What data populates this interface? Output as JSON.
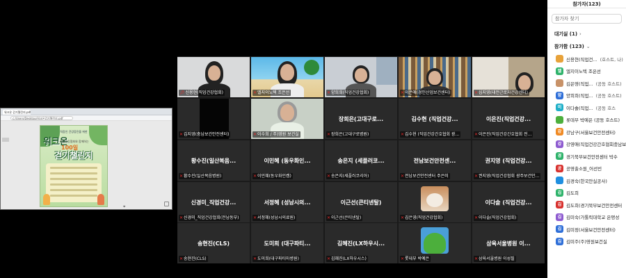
{
  "share": {
    "tab_title": "워크온 걷기챌린지.pdf",
    "url": "c:/Users/Desktop/워크온걷기챌린지.pdf",
    "poster": {
      "top_text": "직장인 건강증진을 위한",
      "title": "워크온",
      "subtitle": "직업건강협회와 함께하는",
      "badge": "100일",
      "main": "걷기챌린지"
    }
  },
  "grid": {
    "tiles": [
      {
        "name": "신용현(직업건강협회)",
        "center": "",
        "video": "woman-dark",
        "pin": true
      },
      {
        "name": "엘지이노텍 조은선",
        "center": "",
        "video": "beach",
        "active": true
      },
      {
        "name": "양희희(직업건강협회)",
        "center": "",
        "video": "office"
      },
      {
        "name": "이은애(경인산업보건센터)",
        "center": "",
        "video": "bookshelf"
      },
      {
        "name": "심지영(대전근로자건강센터)",
        "center": "",
        "video": "woman-shelf"
      },
      {
        "name": "김지영(충남보건안전센터)",
        "center": "",
        "video": "black"
      },
      {
        "name": "이수희 / 주)영원 보건실",
        "center": "",
        "video": "older-woman"
      },
      {
        "name": "장희은(고대구로병원)",
        "center": "장희은(고대구로..."
      },
      {
        "name": "김수현 (직업건강간호협회 광...",
        "center": "김수현 (직업건강..."
      },
      {
        "name": "이은진(직업건강간호협회 전...",
        "center": "이은진(직업건강..."
      },
      {
        "name": "황수진(일산복음병원)",
        "center": "황수진(일산복음..."
      },
      {
        "name": "이민혜(동우화인켐)",
        "center": "이민혜 (동우화인..."
      },
      {
        "name": "송은지(세플러코리아)",
        "center": "송은지 (세플러코..."
      },
      {
        "name": "전남보건안전센터 주은미",
        "center": "전남보건안전센..."
      },
      {
        "name": "권지영(직업건강협회 광주보건안...",
        "center": "권지영 (직업건강..."
      },
      {
        "name": "신경미_직업건강협회(전남동부)",
        "center": "신경미_직업건강..."
      },
      {
        "name": "서정혜(성남시의료원)",
        "center": "서정혜 (성남시의..."
      },
      {
        "name": "이근선(큰티넨탈)",
        "center": "이근선(큰티넨탈)"
      },
      {
        "name": "김은영(직업건강협회)",
        "center": "",
        "video": "cat"
      },
      {
        "name": "이다솔(직업건강협회)",
        "center": "이다솔 (직업건강..."
      },
      {
        "name": "송현진(CLS)",
        "center": "송현진(CLS)"
      },
      {
        "name": "도미희(대구파티마병원)",
        "center": "도미희 (대구파티..."
      },
      {
        "name": "김혜진(LX하우시스)",
        "center": "김혜진(LX하우시..."
      },
      {
        "name": "롯데부 박예은",
        "center": "",
        "video": "frog"
      },
      {
        "name": "삼육서울병원 이성필",
        "center": "삼육서울병원 이..."
      }
    ]
  },
  "panel": {
    "title": "참가자(123)",
    "search_placeholder": "참가자 찾기",
    "waiting_label": "대기실 (1)",
    "participants_label": "참가함 (123)",
    "rows": [
      {
        "initial": "",
        "color": "#e8a23a",
        "name": "신용현(직업건...",
        "role": "(호스트, 나)",
        "photo": true
      },
      {
        "initial": "엘",
        "color": "#2fb36b",
        "name": "엘지이노텍 조은선",
        "role": ""
      },
      {
        "initial": "",
        "color": "#c89268",
        "name": "김은영(직업...",
        "role": "(공동 호스트)",
        "photo": true
      },
      {
        "initial": "양",
        "color": "#2f6fd8",
        "name": "양희희(직업...",
        "role": "(공동 호스트)"
      },
      {
        "initial": "이",
        "color": "#1fb0c8",
        "name": "이다솔(직업...",
        "role": "(공동 호스"
      },
      {
        "initial": "",
        "color": "#4caf3c",
        "name": "롯데부 박예은 (공동 호스트)",
        "role": "",
        "photo": true
      },
      {
        "initial": "강",
        "color": "#f08a24",
        "name": "강남구(서울보건안전센터)",
        "role": ""
      },
      {
        "initial": "강",
        "color": "#8e5bd0",
        "name": "강영애(직업건강간호협회충남보건",
        "role": ""
      },
      {
        "initial": "경",
        "color": "#2fb36b",
        "name": "경기북부보건안전센터 박수",
        "role": ""
      },
      {
        "initial": "공",
        "color": "#d8322f",
        "name": "공영출소원_어선빈",
        "role": ""
      },
      {
        "initial": "",
        "color": "#1f8fe0",
        "name": "김경숙(한국안실공사)",
        "role": "",
        "photo": true
      },
      {
        "initial": "김",
        "color": "#2fb36b",
        "name": "김도희",
        "role": ""
      },
      {
        "initial": "김",
        "color": "#d8322f",
        "name": "김도희(경기북부보건안전센터",
        "role": ""
      },
      {
        "initial": "김",
        "color": "#8e5bd0",
        "name": "김미숙(가톨릭대학교 은평성",
        "role": ""
      },
      {
        "initial": "김",
        "color": "#2f6fd8",
        "name": "김미정(서울보건안전센터)",
        "role": ""
      },
      {
        "initial": "김",
        "color": "#2f6fd8",
        "name": "김미주(주)영원보건실",
        "role": ""
      }
    ]
  }
}
